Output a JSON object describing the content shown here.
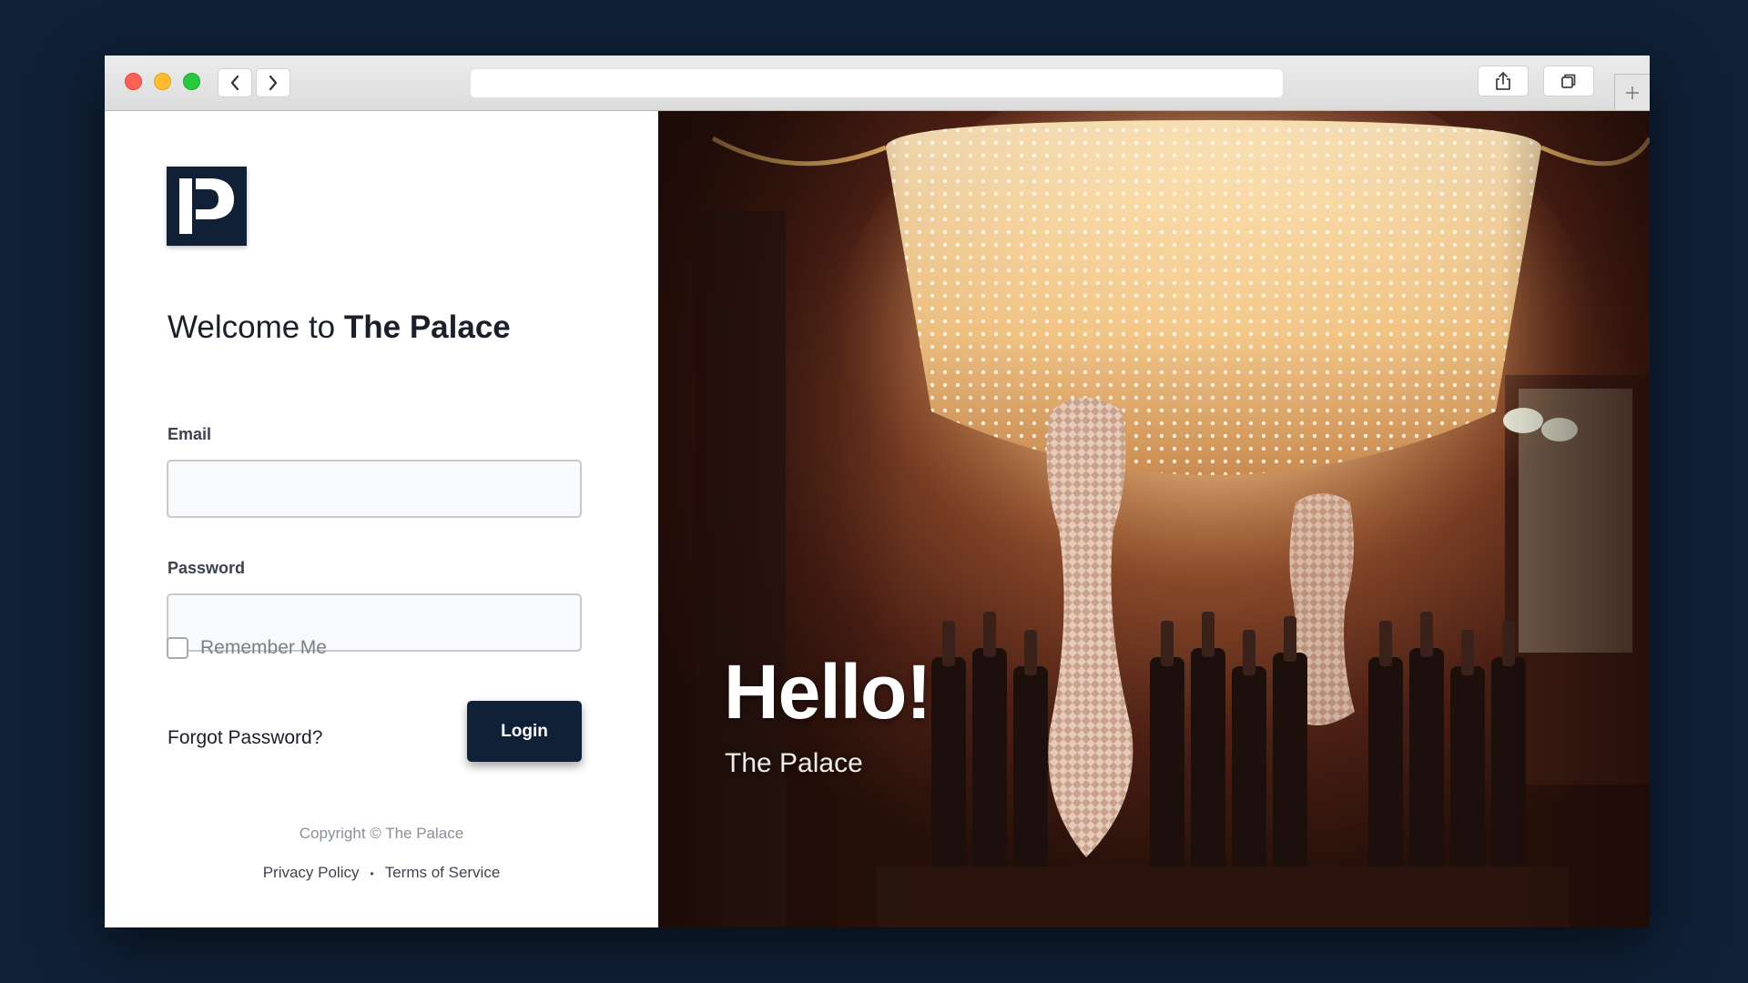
{
  "login": {
    "logo_letter": "P",
    "heading_prefix": "Welcome to ",
    "heading_brand": "The Palace",
    "email_label": "Email",
    "email_value": "",
    "password_label": "Password",
    "password_value": "",
    "remember_label": "Remember Me",
    "remember_checked": false,
    "forgot_label": "Forgot Password?",
    "login_button": "Login",
    "copyright": "Copyright © The Palace",
    "privacy_link": "Privacy Policy",
    "separator": "•",
    "terms_link": "Terms of Service"
  },
  "hero": {
    "title": "Hello!",
    "subtitle": "The Palace"
  },
  "colors": {
    "brand_navy": "#102036",
    "page_background": "#102036",
    "text_dark": "#1b1f2a"
  },
  "icons": [
    "back-arrow-icon",
    "forward-arrow-icon",
    "share-icon",
    "tabs-icon",
    "plus-icon"
  ]
}
